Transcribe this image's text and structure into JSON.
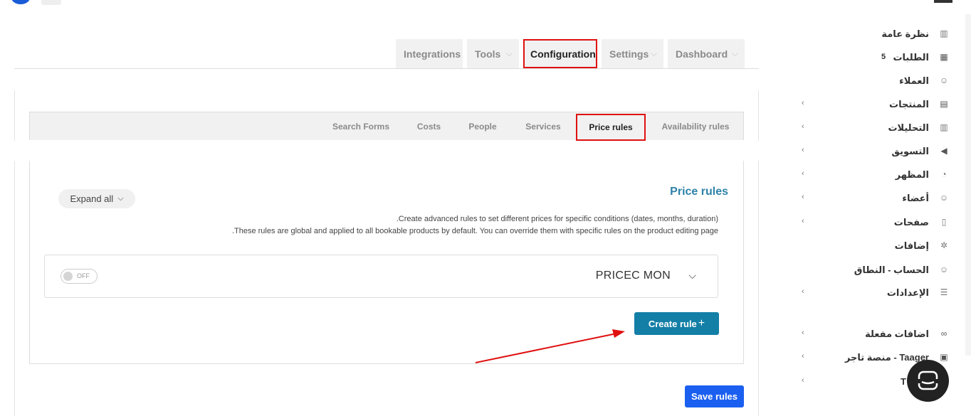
{
  "top_tabs": {
    "integrations": "Integrations",
    "tools": "Tools",
    "configuration": "Configuration",
    "settings": "Settings",
    "dashboard": "Dashboard"
  },
  "sub_tabs": {
    "search_forms": "Search Forms",
    "costs": "Costs",
    "people": "People",
    "services": "Services",
    "price_rules": "Price rules",
    "availability_rules": "Availability rules"
  },
  "panel": {
    "title": "Price rules",
    "expand_label": "Expand all",
    "desc_line1": ".Create advanced rules to set different prices for specific conditions (dates, months, duration)",
    "desc_line2": ".These rules are global and applied to all bookable products by default. You can override them with specific rules on the product editing page",
    "rule_name": "PRICEC MON",
    "toggle_label": "OFF",
    "create_label": "Create rule",
    "save_label": "Save rules"
  },
  "sidebar": {
    "items": [
      {
        "label": "نظرة عامة",
        "icon": "chart-icon"
      },
      {
        "label": "الطلبات",
        "icon": "grid-icon",
        "count": "5"
      },
      {
        "label": "العملاء",
        "icon": "users-icon"
      },
      {
        "label": "المنتجات",
        "icon": "box-icon"
      },
      {
        "label": "التحليلات",
        "icon": "chart-icon"
      },
      {
        "label": "التسويق",
        "icon": "megaphone-icon"
      },
      {
        "label": "المظهر",
        "icon": "palette-icon"
      },
      {
        "label": "أعضاء",
        "icon": "users-icon"
      },
      {
        "label": "صفحات",
        "icon": "page-icon"
      },
      {
        "label": "إضافات",
        "icon": "puzzle-icon"
      },
      {
        "label": "الحساب - النطاق",
        "icon": "users-icon"
      },
      {
        "label": "الإعدادات",
        "icon": "sliders-icon"
      },
      {
        "label": "اضافات مفعلة",
        "icon": "link-icon"
      },
      {
        "label": "Taager - منصة تاجر",
        "icon": "taager-icon"
      },
      {
        "label": "T",
        "icon": "none"
      }
    ]
  },
  "colors": {
    "accent": "#137fa6",
    "title": "#2e82a8",
    "save": "#1a5ff0",
    "highlight": "#e01010"
  }
}
